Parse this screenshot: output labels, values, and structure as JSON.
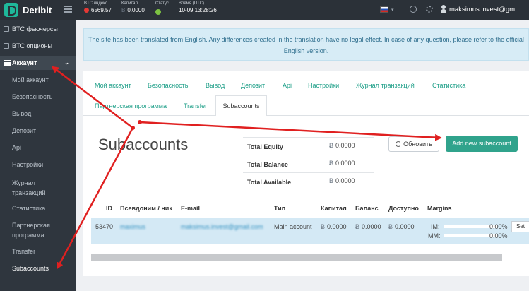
{
  "app": {
    "logo_text": "Deribit"
  },
  "header": {
    "stats": [
      {
        "label": "BTC индекс",
        "value": "6569.57"
      },
      {
        "label": "Капитал",
        "value": "0.0000"
      },
      {
        "label": "Статус",
        "value": ""
      },
      {
        "label": "Время (UTC)",
        "value": "10-09 13:28:26"
      }
    ],
    "btc_symbol": "Ƀ",
    "user_email": "maksimus.invest@gm..."
  },
  "sidebar": {
    "top_items": [
      {
        "label": "BTC фьючерсы"
      },
      {
        "label": "BTC опционы"
      }
    ],
    "section": {
      "label": "Аккаунт",
      "chevron": "⌄"
    },
    "sub_items": [
      {
        "label": "Мой аккаунт"
      },
      {
        "label": "Безопасность"
      },
      {
        "label": "Вывод"
      },
      {
        "label": "Депозит"
      },
      {
        "label": "Api"
      },
      {
        "label": "Настройки"
      },
      {
        "label": "Журнал транзакций"
      },
      {
        "label": "Статистика"
      },
      {
        "label": "Партнерская программа"
      },
      {
        "label": "Transfer"
      },
      {
        "label": "Subaccounts"
      }
    ]
  },
  "notice": {
    "text": "The site has been translated from English. Any differences created in the translation have no legal effect. In case of any question, please refer to the official English version."
  },
  "tabs": [
    {
      "label": "Мой аккаунт"
    },
    {
      "label": "Безопасность"
    },
    {
      "label": "Вывод"
    },
    {
      "label": "Депозит"
    },
    {
      "label": "Api"
    },
    {
      "label": "Настройки"
    },
    {
      "label": "Журнал транзакций"
    },
    {
      "label": "Статистика"
    },
    {
      "label": "Партнерская программа"
    },
    {
      "label": "Transfer"
    },
    {
      "label": "Subaccounts"
    }
  ],
  "page": {
    "title": "Subaccounts",
    "summary": [
      {
        "label": "Total Equity",
        "value": "0.0000"
      },
      {
        "label": "Total Balance",
        "value": "0.0000"
      },
      {
        "label": "Total Available",
        "value": "0.0000"
      }
    ],
    "refresh_label": "Обновить",
    "add_label": "Add new subaccount"
  },
  "table": {
    "columns": [
      "ID",
      "Псевдоним / ник",
      "E-mail",
      "Тип",
      "Капитал",
      "Баланс",
      "Доступно",
      "Margins"
    ],
    "row": {
      "id": "53470",
      "nick": "maximus",
      "email": "maksimus.invest@gmail.com",
      "type": "Main account",
      "capital": "0.0000",
      "balance": "0.0000",
      "available": "0.0000",
      "im_label": "IM:",
      "im_value": "0.00%",
      "mm_label": "MM:",
      "mm_value": "0.00%",
      "action": "Set"
    }
  },
  "colors": {
    "accent": "#30a38c",
    "link": "#1c9e87",
    "topbar": "#2b3138",
    "sidebar": "#2f363e",
    "annotation": "#e02020"
  }
}
